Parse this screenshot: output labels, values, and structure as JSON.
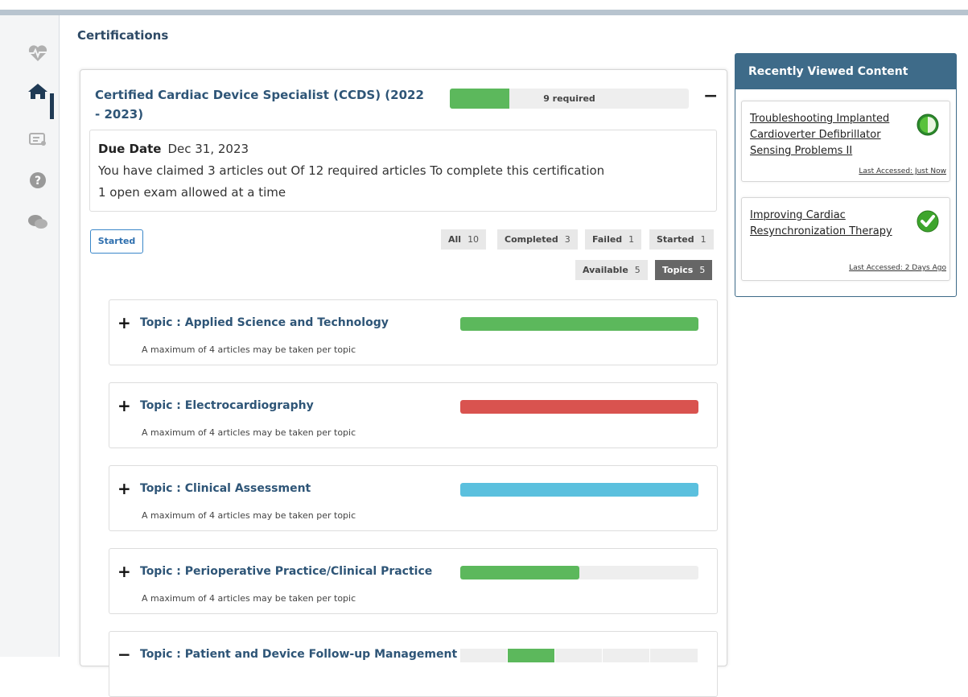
{
  "page": {
    "title": "Certifications"
  },
  "sidebar": {
    "icons": [
      "heartbeat-icon",
      "home-icon",
      "certificate-icon",
      "help-icon",
      "chat-icon"
    ]
  },
  "certification": {
    "title": "Certified Cardiac Device Specialist (CCDS) (2022 - 2023)",
    "requirement_text": "9 required",
    "progress_fraction": 0.25,
    "collapse_label": "−",
    "due_label": "Due Date",
    "due_value": "Dec 31, 2023",
    "claimed_text": "You have claimed 3 articles out Of 12 required articles To complete this certification",
    "exam_text": "1 open exam allowed at a time"
  },
  "status_button": "Started",
  "filters": [
    {
      "label": "All",
      "count": "10"
    },
    {
      "label": "Completed",
      "count": "3"
    },
    {
      "label": "Failed",
      "count": "1"
    },
    {
      "label": "Started",
      "count": "1"
    },
    {
      "label": "Available",
      "count": "5"
    },
    {
      "label": "Topics",
      "count": "5"
    }
  ],
  "topics": [
    {
      "expand": "+",
      "title": "Topic : Applied Science and Technology",
      "note": "A maximum of 4 articles may be taken per topic",
      "progress": 1.0,
      "color": "#5cb85c"
    },
    {
      "expand": "+",
      "title": "Topic : Electrocardiography",
      "note": "A maximum of 4 articles may be taken per topic",
      "progress": 1.0,
      "color": "#d9534f"
    },
    {
      "expand": "+",
      "title": "Topic : Clinical Assessment",
      "note": "A maximum of 4 articles may be taken per topic",
      "progress": 1.0,
      "color": "#5bc0de"
    },
    {
      "expand": "+",
      "title": "Topic : Perioperative Practice/Clinical Practice",
      "note": "A maximum of 4 articles may be taken per topic",
      "progress": 0.5,
      "color": "#5cb85c"
    },
    {
      "expand": "−",
      "title": "Topic : Patient and Device Follow-up Management",
      "note": "",
      "progress": 0.2,
      "color": "#5cb85c"
    }
  ],
  "recently_viewed": {
    "header": "Recently Viewed Content",
    "items": [
      {
        "title": "Troubleshooting Implanted Cardioverter Defibrillator Sensing Problems II",
        "accessed": "Last Accessed: Just Now",
        "status_icon": "half-progress-icon"
      },
      {
        "title": "Improving Cardiac Resynchronization Therapy",
        "accessed": "Last Accessed: 2 Days Ago",
        "status_icon": "check-icon"
      }
    ]
  },
  "colors": {
    "green": "#5cb85c",
    "red": "#d9534f",
    "blue": "#5bc0de",
    "panel_header": "#3e6b89"
  }
}
